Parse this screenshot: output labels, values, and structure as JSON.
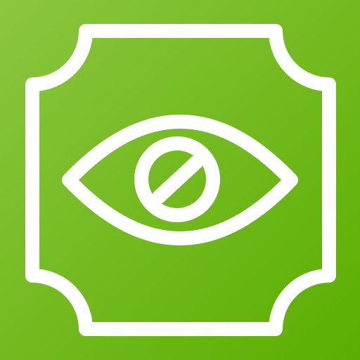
{
  "app_icon": {
    "name": "hidden-eye-app-icon",
    "glyph": "eye-with-blocked-pupil-icon",
    "frame": "ticket-frame-icon",
    "colors": {
      "background_start": "#8cc63f",
      "background_end": "#5aae00",
      "foreground": "#ffffff"
    }
  }
}
